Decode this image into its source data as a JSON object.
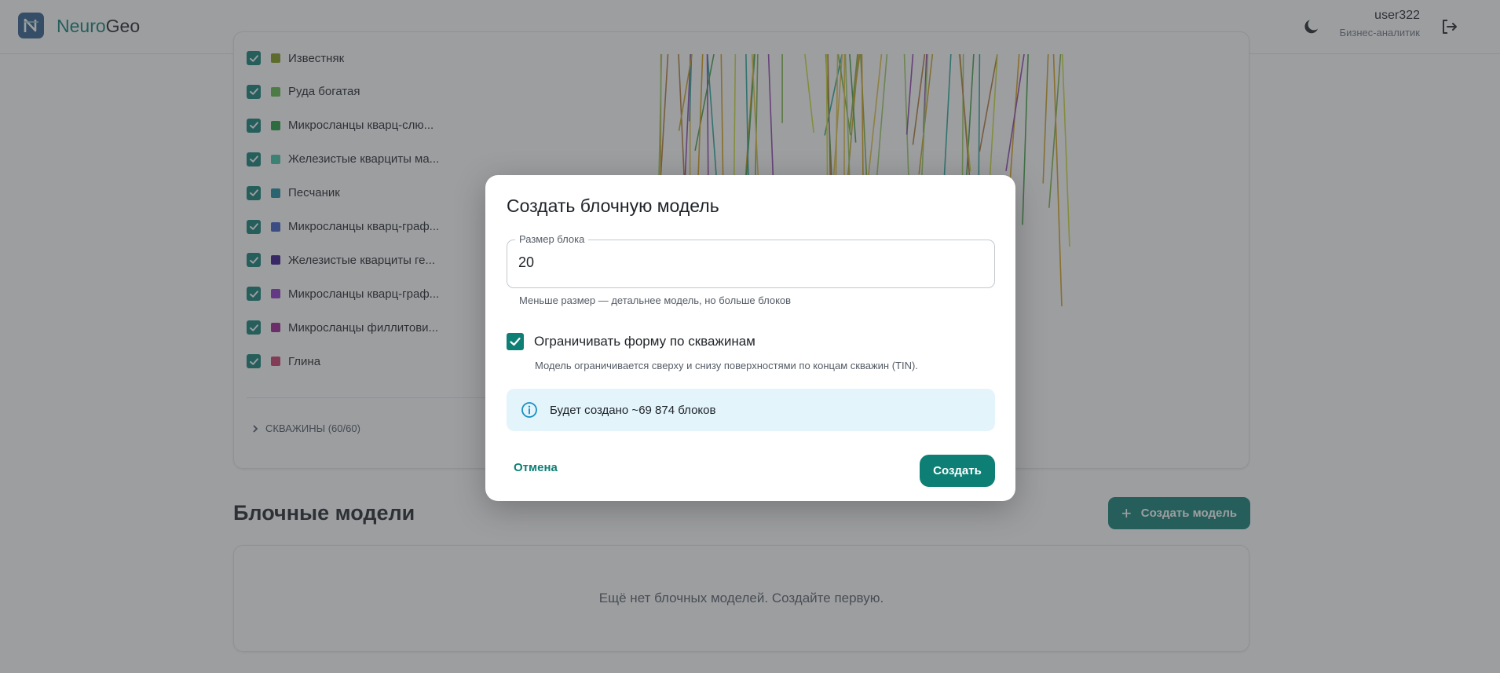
{
  "header": {
    "brand_part1": "Neuro",
    "brand_part2": "Geo",
    "user_name": "user322",
    "user_role": "Бизнес-аналитик"
  },
  "layers": [
    {
      "label": "Известняк",
      "color": "#7f9a18",
      "checked": true
    },
    {
      "label": "Руда богатая",
      "color": "#5cb84a",
      "checked": true
    },
    {
      "label": "Микросланцы кварц-слю...",
      "color": "#1e9a3e",
      "checked": true
    },
    {
      "label": "Железистые кварциты ма...",
      "color": "#3fc4a9",
      "checked": true
    },
    {
      "label": "Песчаник",
      "color": "#168a9e",
      "checked": true
    },
    {
      "label": "Микросланцы кварц-граф...",
      "color": "#3d5cc7",
      "checked": true
    },
    {
      "label": "Железистые кварциты ге...",
      "color": "#34158a",
      "checked": true
    },
    {
      "label": "Микросланцы кварц-граф...",
      "color": "#8a35c9",
      "checked": true
    },
    {
      "label": "Микросланцы филлитови...",
      "color": "#9b1f8f",
      "checked": true
    },
    {
      "label": "Глина",
      "color": "#c93a6b",
      "checked": true
    }
  ],
  "wells_toggle": "СКВАЖИНЫ (60/60)",
  "block_models": {
    "title": "Блочные модели",
    "create_button": "Создать модель",
    "create_icon": "+",
    "empty_text": "Ещё нет блочных моделей. Создайте первую."
  },
  "dialog": {
    "title": "Создать блочную модель",
    "block_size_label": "Размер блока",
    "block_size_value": "20",
    "block_size_hint": "Меньше размер — детальнее модель, но больше блоков",
    "limit_label": "Ограничивать форму по скважинам",
    "limit_checked": true,
    "limit_description": "Модель ограничивается сверху и снизу поверхностями по концам скважин (TIN).",
    "info_text": "Будет создано ~69 874 блоков",
    "cancel_label": "Отмена",
    "submit_label": "Создать"
  },
  "colors": {
    "accent": "#0e7f75",
    "info_bg": "#e3f4fb"
  }
}
